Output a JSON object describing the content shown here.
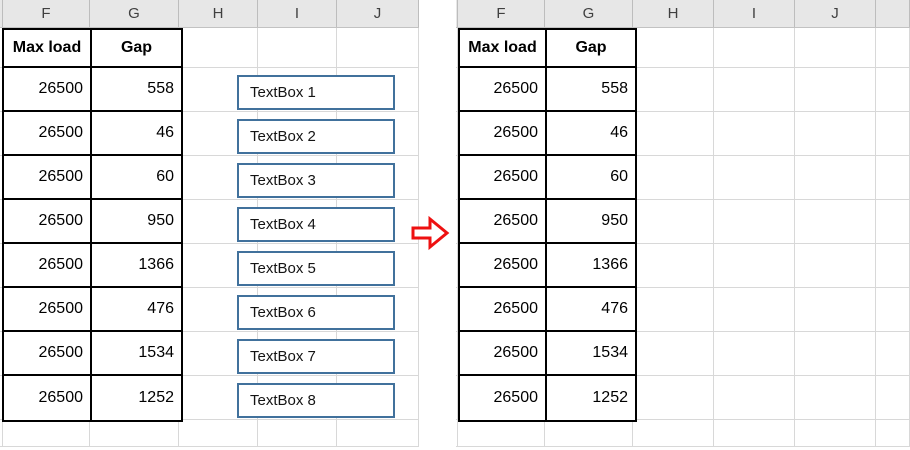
{
  "columns": [
    "F",
    "G",
    "H",
    "I",
    "J"
  ],
  "table": {
    "headers": [
      "Max load",
      "Gap"
    ],
    "rows": [
      [
        "26500",
        "558"
      ],
      [
        "26500",
        "46"
      ],
      [
        "26500",
        "60"
      ],
      [
        "26500",
        "950"
      ],
      [
        "26500",
        "1366"
      ],
      [
        "26500",
        "476"
      ],
      [
        "26500",
        "1534"
      ],
      [
        "26500",
        "1252"
      ]
    ]
  },
  "textboxes": [
    "TextBox 1",
    "TextBox 2",
    "TextBox 3",
    "TextBox 4",
    "TextBox 5",
    "TextBox 6",
    "TextBox 7",
    "TextBox 8"
  ],
  "icons": {
    "arrow": "right-block-arrow"
  },
  "colors": {
    "arrow": "#EE1111",
    "textbox_border": "#41719C",
    "header_bg": "#E7E7E7",
    "gridline": "#D8D8D8",
    "table_border": "#000000"
  }
}
